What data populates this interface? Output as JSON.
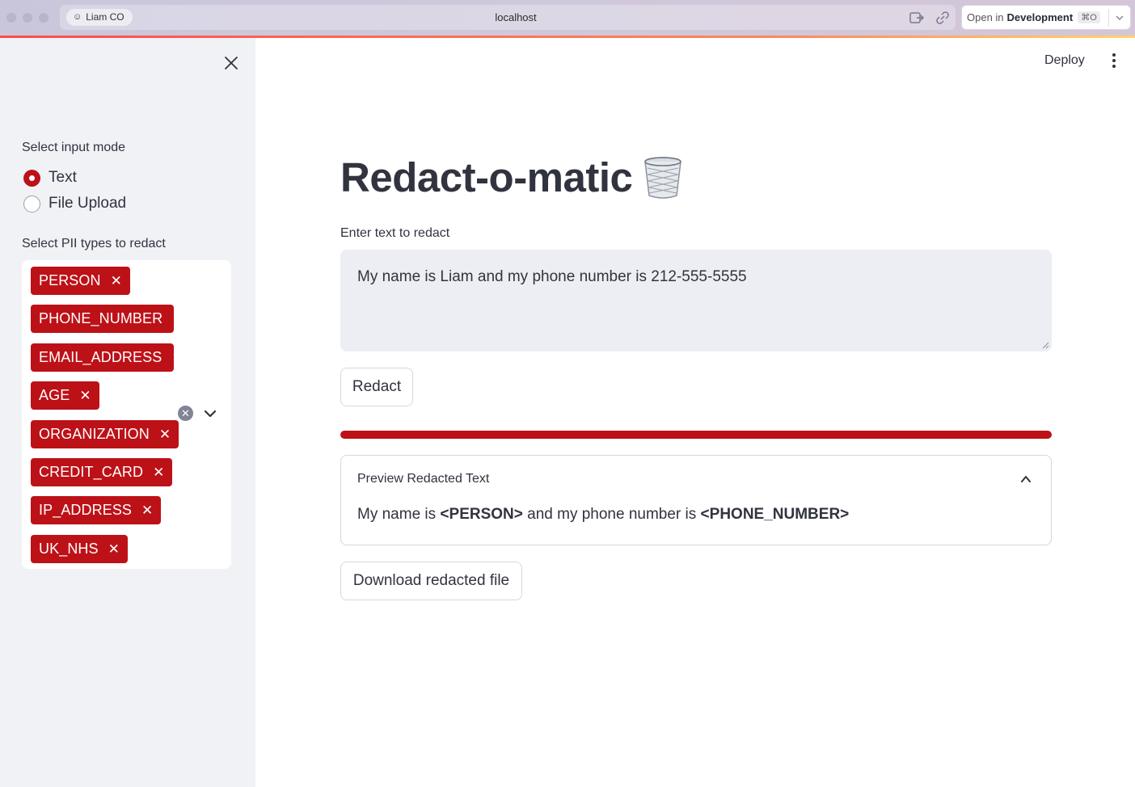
{
  "browser": {
    "profile_label": "Liam CO",
    "url": "localhost",
    "open_in_prefix": "Open in",
    "open_in_target": "Development",
    "open_in_shortcut": "⌘O"
  },
  "sidebar": {
    "input_mode_label": "Select input mode",
    "input_modes": [
      {
        "label": "Text",
        "selected": true
      },
      {
        "label": "File Upload",
        "selected": false
      }
    ],
    "pii_label": "Select PII types to redact",
    "pii_tags": [
      "PERSON",
      "PHONE_NUMBER",
      "EMAIL_ADDRESS",
      "AGE",
      "ORGANIZATION",
      "CREDIT_CARD",
      "IP_ADDRESS",
      "UK_NHS"
    ],
    "tag_remove_glyph": "✕",
    "clear_all_glyph": "✕"
  },
  "header": {
    "deploy_label": "Deploy"
  },
  "main": {
    "title": "Redact-o-matic",
    "title_icon": "wastebasket-icon",
    "text_input_label": "Enter text to redact",
    "text_input_value": "My name is Liam and my phone number is 212-555-5555",
    "redact_button": "Redact",
    "progress_fraction": 1.0,
    "preview": {
      "header": "Preview Redacted Text",
      "segments": [
        {
          "text": "My name is ",
          "bold": false
        },
        {
          "text": "<PERSON>",
          "bold": true
        },
        {
          "text": " and my phone number is ",
          "bold": false
        },
        {
          "text": "<PHONE_NUMBER>",
          "bold": true
        }
      ]
    },
    "download_button": "Download redacted file"
  },
  "colors": {
    "accent": "#bd1118",
    "sidebar_bg": "#f0f2f6",
    "text": "#31333f",
    "input_bg": "#eceef3"
  }
}
